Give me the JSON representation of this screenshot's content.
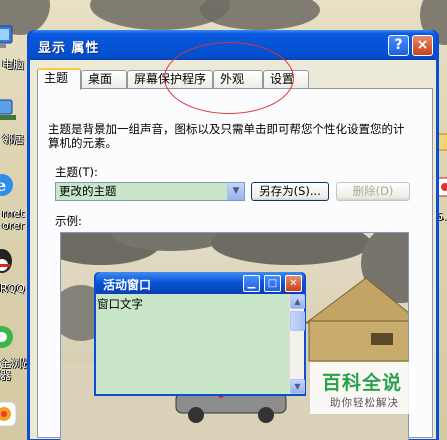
{
  "desktop": {
    "icons": [
      {
        "label": "电脑",
        "icon": "my-computer-icon"
      },
      {
        "label": "邻居",
        "icon": "network-places-icon"
      },
      {
        "label": "rnet\norer",
        "icon": "internet-explorer-icon"
      },
      {
        "label": "RQQ",
        "icon": "qq-icon"
      },
      {
        "label": "全浏览\n器",
        "icon": "360-browser-icon"
      }
    ],
    "right_icon_label": "6."
  },
  "window": {
    "title": "显示 属性",
    "help_symbol": "?",
    "close_symbol": "×"
  },
  "tabs": [
    "主题",
    "桌面",
    "屏幕保护程序",
    "外观",
    "设置"
  ],
  "active_tab": "主题",
  "theme_page": {
    "description": "主题是背景加一组声音，图标以及只需单击即可帮您个性化设置您的计算机的元素。",
    "theme_label": "主题(T):",
    "theme_value": "更改的主题",
    "save_as_label": "另存为(S)...",
    "delete_label": "删除(D)",
    "preview_label": "示例:"
  },
  "preview_window": {
    "title": "活动窗口",
    "body_text": "窗口文字"
  },
  "watermark": {
    "title": "百科全说",
    "subtitle": "助你轻松解决"
  }
}
